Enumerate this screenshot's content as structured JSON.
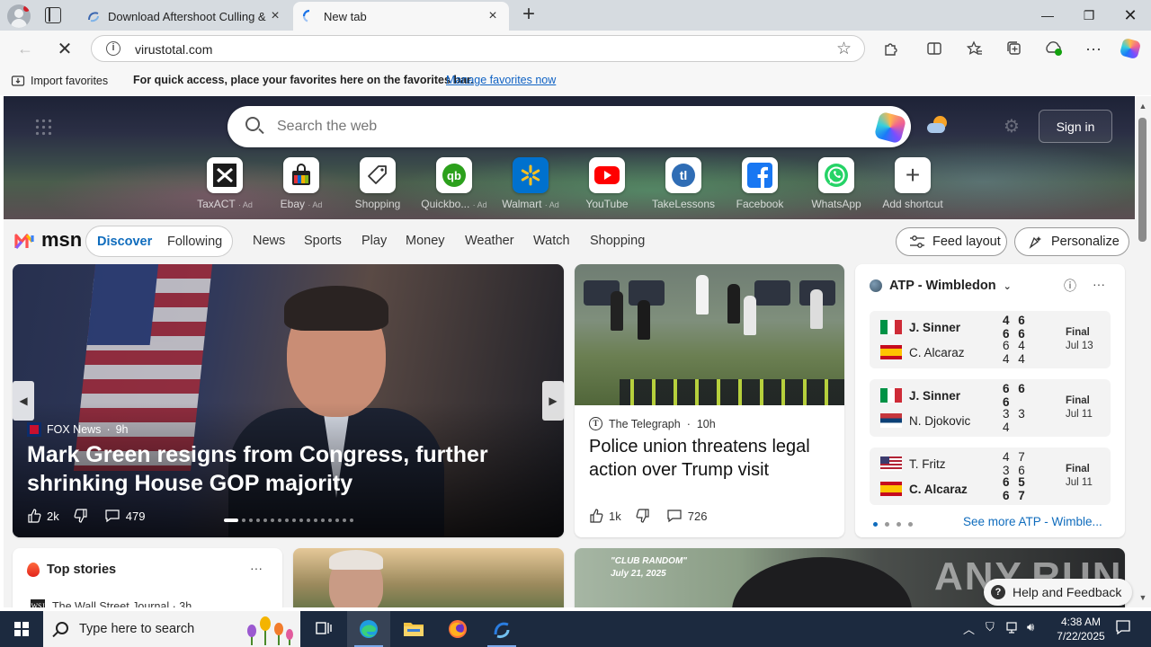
{
  "browser": {
    "tabs": [
      {
        "title": "Download Aftershoot Culling & E",
        "active": false
      },
      {
        "title": "New tab",
        "active": true
      }
    ],
    "url": "virustotal.com",
    "favorites_bar": {
      "import_label": "Import favorites",
      "message": "For quick access, place your favorites here on the favorites bar.",
      "manage_link": "Manage favorites now"
    }
  },
  "newtab": {
    "search_placeholder": "Search the web",
    "sign_in": "Sign in",
    "shortcuts": [
      {
        "label": "TaxACT",
        "ad": "· Ad",
        "icon": "taxact-icon"
      },
      {
        "label": "Ebay",
        "ad": "· Ad",
        "icon": "ebay-icon"
      },
      {
        "label": "Shopping",
        "ad": "",
        "icon": "shopping-tag-icon"
      },
      {
        "label": "Quickbo...",
        "ad": "· Ad",
        "icon": "quickbooks-icon"
      },
      {
        "label": "Walmart",
        "ad": "· Ad",
        "icon": "walmart-icon"
      },
      {
        "label": "YouTube",
        "ad": "",
        "icon": "youtube-icon"
      },
      {
        "label": "TakeLessons",
        "ad": "",
        "icon": "takelessons-icon"
      },
      {
        "label": "Facebook",
        "ad": "",
        "icon": "facebook-icon"
      },
      {
        "label": "WhatsApp",
        "ad": "",
        "icon": "whatsapp-icon"
      },
      {
        "label": "Add shortcut",
        "ad": "",
        "icon": "plus-icon"
      }
    ]
  },
  "msn": {
    "logo": "msn",
    "segment": {
      "discover": "Discover",
      "following": "Following"
    },
    "nav": [
      "News",
      "Sports",
      "Play",
      "Money",
      "Weather",
      "Watch",
      "Shopping"
    ],
    "feed_layout": "Feed layout",
    "personalize": "Personalize"
  },
  "lead_story": {
    "source": "FOX News",
    "age": "9h",
    "headline": "Mark Green resigns from Congress, further shrinking House GOP majority",
    "likes": "2k",
    "comments": "479"
  },
  "telegraph_story": {
    "source": "The Telegraph",
    "age": "10h",
    "headline": "Police union threatens legal action over Trump visit",
    "likes": "1k",
    "comments": "726"
  },
  "sports_card": {
    "title": "ATP - Wimbledon",
    "matches": [
      {
        "players": [
          {
            "name": "J. Sinner",
            "scores": "4 6 6 6",
            "winner": true,
            "flag": "italy"
          },
          {
            "name": "C. Alcaraz",
            "scores": "6 4 4 4",
            "winner": false,
            "flag": "spain"
          }
        ],
        "status": "Final",
        "date": "Jul 13"
      },
      {
        "players": [
          {
            "name": "J. Sinner",
            "scores": "6 6 6",
            "winner": true,
            "flag": "italy"
          },
          {
            "name": "N. Djokovic",
            "scores": "3 3 4",
            "winner": false,
            "flag": "serbia"
          }
        ],
        "status": "Final",
        "date": "Jul 11"
      },
      {
        "players": [
          {
            "name": "T. Fritz",
            "scores": "4 7 3 6",
            "winner": false,
            "flag": "usa"
          },
          {
            "name": "C. Alcaraz",
            "scores": "6 5 6 7",
            "winner": true,
            "flag": "spain"
          }
        ],
        "status": "Final",
        "date": "Jul 11"
      }
    ],
    "see_more": "See more ATP - Wimble..."
  },
  "top_stories": {
    "title": "Top stories",
    "first_source": "The Wall Street Journal · 3h"
  },
  "image_caption": "\"CLUB RANDOM\"\nJuly 21, 2025",
  "help_feedback": "Help and Feedback",
  "watermark": "ANY.RUN",
  "taskbar": {
    "search_placeholder": "Type here to search",
    "time": "4:38 AM",
    "date": "7/22/2025"
  }
}
